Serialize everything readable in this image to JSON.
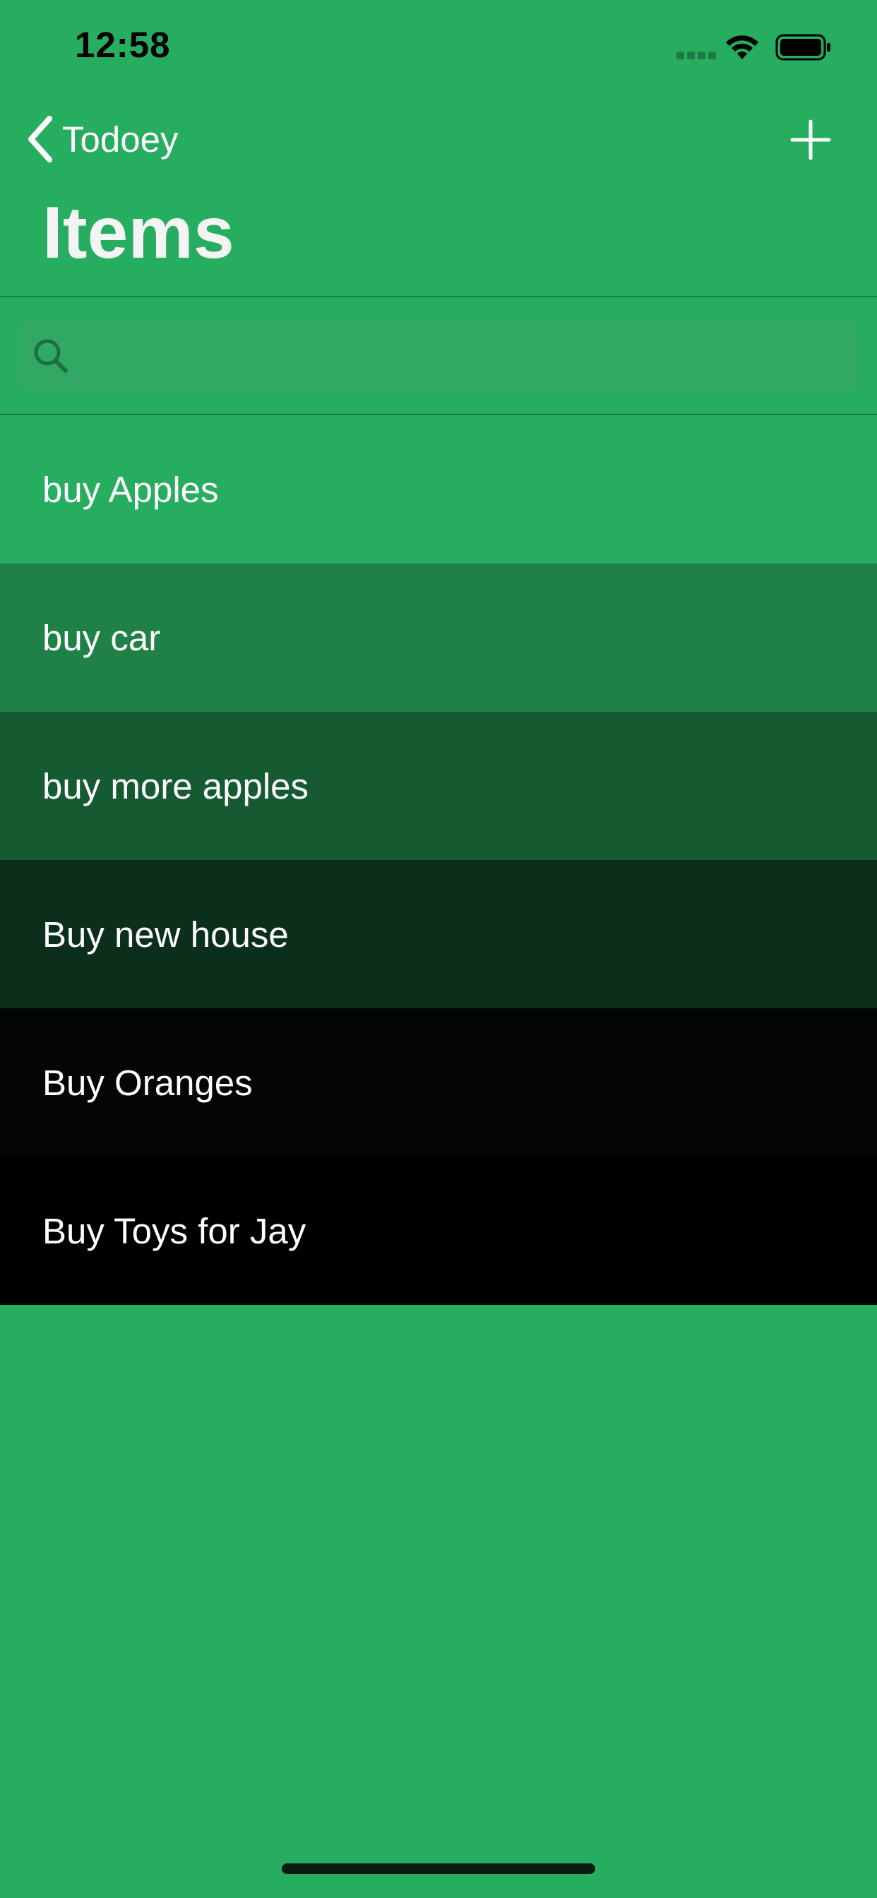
{
  "status_bar": {
    "time": "12:58",
    "icons": [
      "signal-icon",
      "wifi-icon",
      "battery-icon"
    ]
  },
  "nav": {
    "back_label": "Todoey",
    "back_icon": "chevron-left-icon",
    "add_icon": "plus-icon"
  },
  "page": {
    "title": "Items"
  },
  "search": {
    "placeholder": "",
    "value": "",
    "icon": "search-icon"
  },
  "items": [
    {
      "label": "buy Apples",
      "color": "#26ad5f"
    },
    {
      "label": "buy car",
      "color": "#1f8146"
    },
    {
      "label": "buy more apples",
      "color": "#165a31"
    },
    {
      "label": "Buy new house",
      "color": "#0c2f1c"
    },
    {
      "label": "Buy Oranges",
      "color": "#030604"
    },
    {
      "label": "Buy Toys for Jay",
      "color": "#000000"
    }
  ],
  "colors": {
    "background": "#26ad5f",
    "search_field": "#31a864",
    "divider": "#1e7c45"
  }
}
